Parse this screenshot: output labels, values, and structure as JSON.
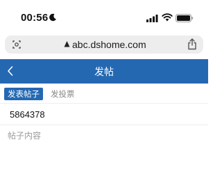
{
  "status_bar": {
    "time": "00:56"
  },
  "browser": {
    "url": "abc.dshome.com"
  },
  "header": {
    "title": "发帖"
  },
  "tabs": [
    {
      "label": "发表帖子",
      "active": true
    },
    {
      "label": "发投票",
      "active": false
    }
  ],
  "form": {
    "title_value": "5864378",
    "content_placeholder": "帖子内容"
  },
  "colors": {
    "brand": "#2468b2"
  }
}
